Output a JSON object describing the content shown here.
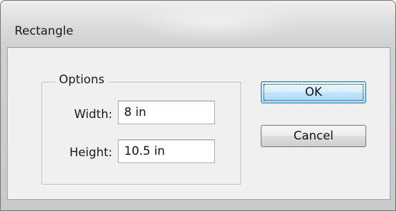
{
  "window": {
    "title": "Rectangle"
  },
  "options": {
    "legend": "Options",
    "width": {
      "label": "Width:",
      "value": "8 in"
    },
    "height": {
      "label": "Height:",
      "value": "10.5 in"
    }
  },
  "buttons": {
    "ok": "OK",
    "cancel": "Cancel"
  }
}
